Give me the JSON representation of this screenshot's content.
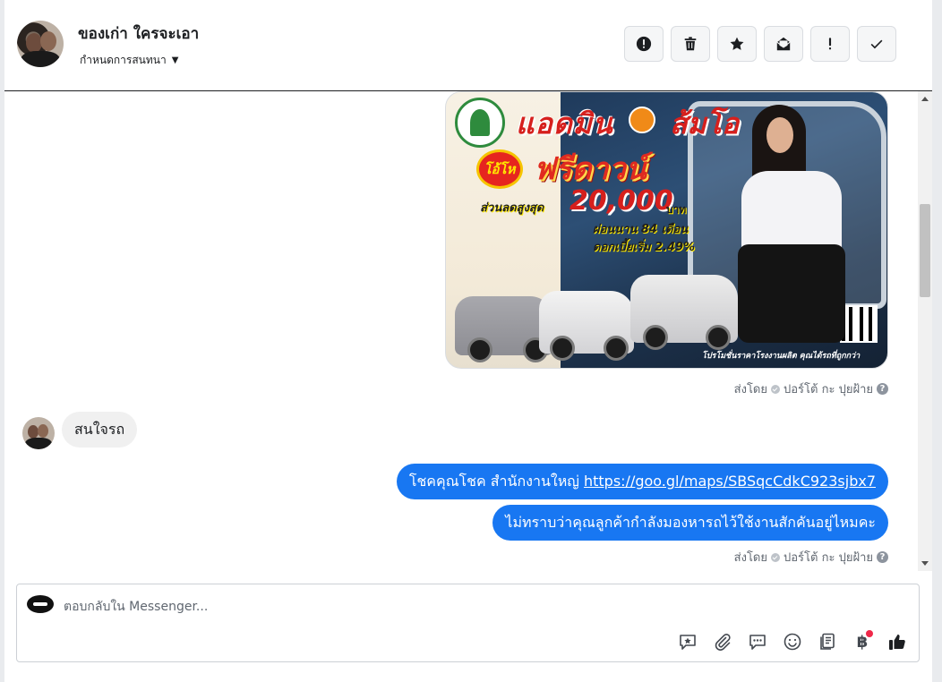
{
  "header": {
    "name": "ของเก่า ใครจะเอา",
    "assign_label": "กำหนดการสนทนา",
    "toolbar": [
      {
        "name": "spam-button",
        "icon": "exclamation-circle-icon"
      },
      {
        "name": "delete-button",
        "icon": "trash-icon"
      },
      {
        "name": "star-button",
        "icon": "star-icon"
      },
      {
        "name": "mark-unread-button",
        "icon": "envelope-icon"
      },
      {
        "name": "follow-up-button",
        "icon": "exclamation-icon"
      },
      {
        "name": "done-button",
        "icon": "check-icon"
      }
    ]
  },
  "ad": {
    "title_left": "แอดมิน",
    "title_right": "ส้มโอ",
    "burst": "โอ้โห",
    "free_down": "ฟรีดาวน์",
    "discount_label": "ส่วนลดสูงสุด",
    "discount_value": "20,000",
    "currency": "บาท",
    "installment": "ผ่อนนาน 84 เดือน",
    "interest": "ดอกเบี้ยเริ่ม 2.49%",
    "footer": "โปรโมชั่นราคาโรงงานผลิต คุณได้รถที่ถูกกว่า"
  },
  "messages": {
    "sent_by_1": "ส่งโดย",
    "sender_1": "ปอร์โต้ กะ ปุยฝ้าย",
    "incoming_text": "สนใจรถ",
    "outgoing_1_text": "โชคคุณโชค สำนักงานใหญ่ ",
    "outgoing_1_link": "https://goo.gl/maps/SBSqcCdkC923sjbx7",
    "outgoing_2_text": "ไม่ทราบว่าคุณลูกค้ากำลังมองหารถไว้ใช้งานสักคันอยู่ไหมคะ",
    "sent_by_2": "ส่งโดย",
    "sender_2": "ปอร์โต้ กะ ปุยฝ้าย",
    "help_glyph": "?"
  },
  "composer": {
    "placeholder": "ตอบกลับใน Messenger...",
    "value": "",
    "baht_symbol": "฿",
    "tools": [
      "saved-reply-icon",
      "attachment-icon",
      "chat-plugin-icon",
      "emoji-icon",
      "template-icon",
      "payment-icon",
      "like-icon"
    ]
  },
  "colors": {
    "accent": "#1877f2",
    "incoming_bubble": "#f0f0f0",
    "notification_dot": "#f02849"
  }
}
